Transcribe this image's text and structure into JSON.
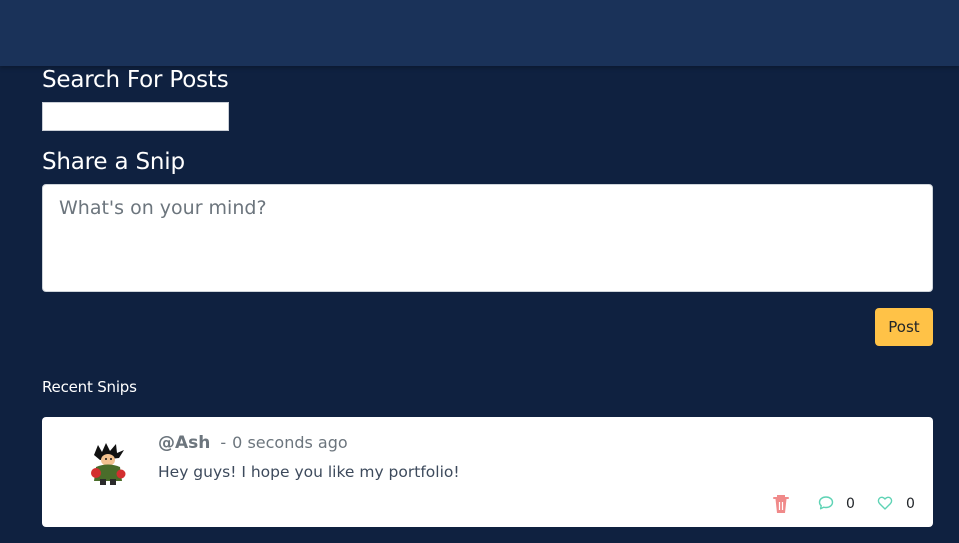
{
  "search": {
    "heading": "Search For Posts",
    "value": "",
    "placeholder": ""
  },
  "share": {
    "heading": "Share a Snip",
    "placeholder": "What's on your mind?",
    "post_label": "Post"
  },
  "recent": {
    "heading": "Recent Snips",
    "snips": [
      {
        "username": "@Ash",
        "separator": "-",
        "time": "0 seconds ago",
        "text": "Hey guys! I hope you like my portfolio!",
        "comments": "0",
        "likes": "0",
        "avatar_icon": "character-avatar",
        "delete_icon": "trash-icon",
        "comment_icon": "comment-icon",
        "like_icon": "heart-icon"
      }
    ]
  },
  "colors": {
    "topbar": "#1a3259",
    "background": "#0f2140",
    "accent": "#ffc247",
    "delete": "#f08a8a",
    "comment": "#5fd3b5",
    "like": "#5fd3b5"
  }
}
